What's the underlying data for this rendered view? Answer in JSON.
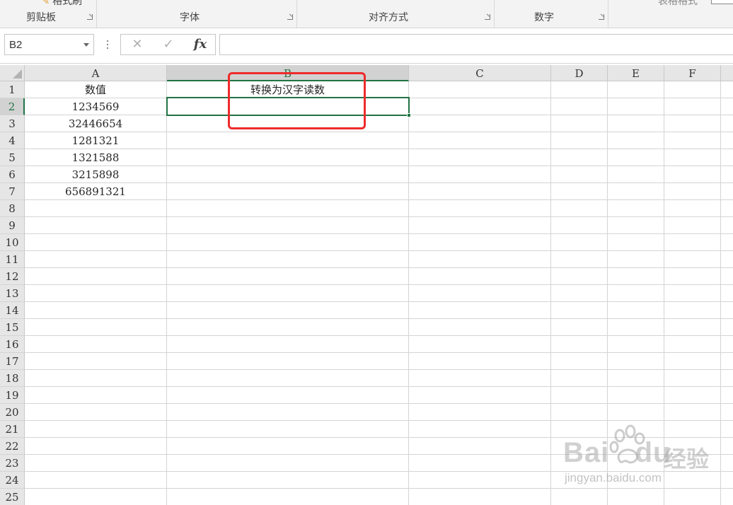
{
  "ribbon": {
    "groups": [
      {
        "label": "剪贴板"
      },
      {
        "label": "字体"
      },
      {
        "label": "对齐方式"
      },
      {
        "label": "数字"
      }
    ],
    "paste_partial": "格式刷",
    "table_style_partial": "表格格式"
  },
  "formula_bar": {
    "name_box": "B2",
    "fx_label": "fx",
    "formula": ""
  },
  "columns": [
    "A",
    "B",
    "C",
    "D",
    "E",
    "F",
    ""
  ],
  "rows": [
    "1",
    "2",
    "3",
    "4",
    "5",
    "6",
    "7",
    "8",
    "9",
    "10",
    "11",
    "12",
    "13",
    "14",
    "15",
    "16",
    "17",
    "18",
    "19",
    "20",
    "21",
    "22",
    "23",
    "24",
    "25"
  ],
  "cells": {
    "A": [
      "数值",
      "1234569",
      "32446654",
      "1281321",
      "1321588",
      "3215898",
      "656891321"
    ],
    "B": [
      "转换为汉字读数",
      "",
      "",
      "",
      "",
      "",
      ""
    ]
  },
  "selection": {
    "column": "B",
    "row": "2"
  },
  "watermark": {
    "logo": "Bai du",
    "brand": "经验",
    "url": "jingyan.baidu.com"
  },
  "colors": {
    "accent": "#217346",
    "annotation": "#ee2b2b"
  }
}
